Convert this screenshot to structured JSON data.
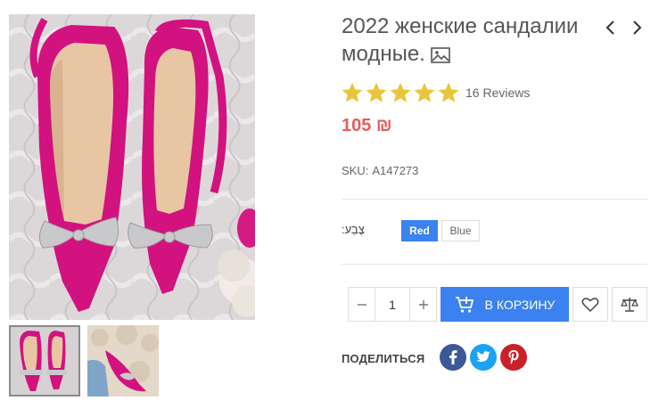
{
  "product": {
    "title": "2022 женские сандалии модные.",
    "rating": 5,
    "reviews": "16 Reviews",
    "price": "105 ₪",
    "sku_label": "SKU:",
    "sku_value": "A147273"
  },
  "options": {
    "color_label": "צֶבַע:",
    "colors": [
      "Red",
      "Blue"
    ],
    "selected": "Red"
  },
  "cart": {
    "quantity": "1",
    "add_label": "В КОРЗИНУ"
  },
  "share": {
    "label": "ПОДЕЛИТЬСЯ",
    "networks": [
      "facebook",
      "twitter",
      "pinterest"
    ]
  },
  "icons": [
    "image-icon",
    "chevron-left-icon",
    "chevron-right-icon",
    "star-icon",
    "cart-plus-icon",
    "heart-icon",
    "scale-icon"
  ],
  "colors": {
    "accent": "#3b82f0",
    "price": "#e85c5c",
    "star": "#e8c53a",
    "shoe": "#d2127e"
  }
}
